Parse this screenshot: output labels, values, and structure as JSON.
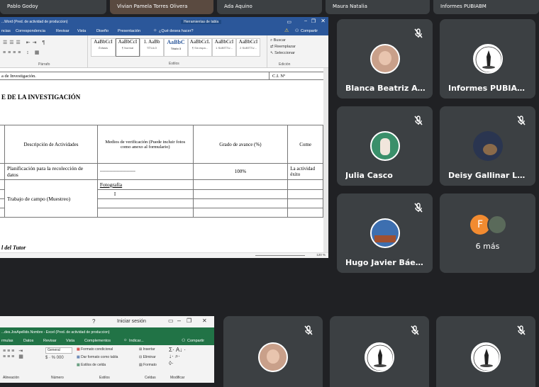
{
  "top_strip": [
    {
      "name": "Pablo Godoy"
    },
    {
      "name": "Vivian Pamela Torres Olivera"
    },
    {
      "name": "Ada Aquino"
    },
    {
      "name": "Maura Natalia"
    },
    {
      "name": "Informes PUBIABM"
    }
  ],
  "word": {
    "title": "...Word (Pred. de actividad de produccion)",
    "table_tools": "Herramientas de tabla",
    "tell_me": "¿Qué desea hacer?",
    "share": "Compartir",
    "menu": [
      "ncias",
      "Correspondencia",
      "Revisar",
      "Vista",
      "Diseño",
      "Presentación"
    ],
    "styles": [
      {
        "preview": "AaBbCcI",
        "name": "Énfasis"
      },
      {
        "preview": "AaBbCcI",
        "name": "¶ Normal"
      },
      {
        "preview": "1. AaBb",
        "name": "TÍTULO"
      },
      {
        "preview": "AaBbC",
        "name": "Título 3"
      },
      {
        "preview": "AaBbCcL",
        "name": "¶ Sin espa..."
      },
      {
        "preview": "AaBbCcI",
        "name": "1 SUBTÍTU..."
      },
      {
        "preview": "AaBbCcI",
        "name": "2 SUBTÍTU..."
      }
    ],
    "edit_group": [
      "Buscar",
      "Reemplazar",
      "Seleccionar"
    ],
    "group_labels": {
      "paragraph": "Párrafo",
      "styles": "Estilos",
      "edit": "Edición"
    },
    "doc": {
      "line1": "a de Investigación.",
      "ci": "C.I. Nº",
      "heading": "E DE LA INVESTIGACIÓN",
      "table": {
        "headers": [
          "Descripción de Actividades",
          "Medios de verificación (Puede incluir fotos como anexo al formulario)",
          "Grado de avance (%)",
          "Come"
        ],
        "row1": {
          "desc": "Planificación para la recolección de datos",
          "medio": "-------------------------",
          "grado": "100%",
          "come": "La actividad éxito"
        },
        "row2": {
          "medio": "Fotografía"
        },
        "row3": {
          "desc": "Trabajo de campo (Muestreo)"
        }
      },
      "footer": "l del Tutor"
    },
    "zoom": "120 %"
  },
  "excel": {
    "signin": "Iniciar sesión",
    "title": "...des.JosApellido.Nombre - Excel (Pred. de actividad de produccion)",
    "share": "Compartir",
    "menu": [
      "rmulas",
      "Datos",
      "Revisar",
      "Vista",
      "Complementos",
      "Indicar..."
    ],
    "number_format": "General",
    "ribbon_items": [
      "Formato condicional",
      "Dar formato como tabla",
      "Estilos de celda",
      "Insertar",
      "Eliminar",
      "Formato"
    ],
    "group_labels": [
      "Alineación",
      "Número",
      "Estilos",
      "Celdas",
      "Modificar"
    ]
  },
  "tiles": [
    {
      "name": "Blanca Beatriz Alo...",
      "type": "photo",
      "photo_color": "#c9a08a"
    },
    {
      "name": "Informes PUBIABM",
      "type": "logo"
    },
    {
      "name": "Julia Casco",
      "type": "photo",
      "photo_color": "#3a8f6a"
    },
    {
      "name": "Deisy Gallinar Lopez",
      "type": "photo",
      "photo_color": "#2a3550"
    },
    {
      "name": "Hugo Javier Báez ...",
      "type": "photo",
      "photo_color": "#3d6fb0"
    },
    {
      "name": "6 más",
      "type": "more",
      "initial": "F"
    }
  ],
  "bottom_tiles": [
    {
      "type": "photo",
      "photo_color": "#c9a08a"
    },
    {
      "type": "logo"
    },
    {
      "type": "logo"
    }
  ],
  "colors": {
    "bg": "#202124",
    "tile": "#3c4043",
    "word_blue": "#2b579a",
    "excel_green": "#217346",
    "more_orange": "#f28b30"
  }
}
